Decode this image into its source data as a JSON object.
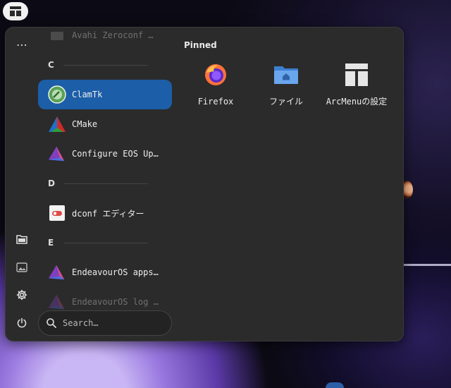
{
  "topbar": {
    "menu_button_icon": "arcmenu-grid-icon"
  },
  "menu": {
    "leftbar": {
      "more_label": "⋯",
      "items": [
        "files-icon",
        "pictures-icon",
        "settings-icon",
        "power-icon"
      ]
    },
    "applist": {
      "faded_top": "Avahi Zeroconf …",
      "sections": [
        {
          "letter": "C",
          "apps": [
            "ClamTk",
            "CMake",
            "Configure EOS Up…"
          ]
        },
        {
          "letter": "D",
          "apps": [
            "dconf エディター"
          ]
        },
        {
          "letter": "E",
          "apps": [
            "EndeavourOS apps…",
            "EndeavourOS log …"
          ]
        }
      ],
      "active_app": "ClamTk"
    },
    "search": {
      "placeholder": "Search…",
      "value": ""
    },
    "pinned": {
      "title": "Pinned",
      "items": [
        {
          "label": "Firefox",
          "icon": "firefox-icon"
        },
        {
          "label": "ファイル",
          "icon": "folder-icon"
        },
        {
          "label": "ArcMenuの設定",
          "icon": "arcmenu-settings-icon"
        }
      ]
    }
  },
  "colors": {
    "menu_bg": "#2b2b2b",
    "accent": "#1c5ea8"
  }
}
